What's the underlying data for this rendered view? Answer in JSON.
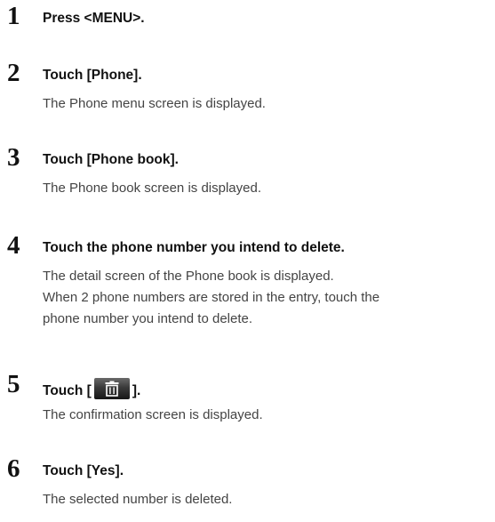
{
  "steps": [
    {
      "num": "1",
      "title": "Press <MENU>.",
      "desc": []
    },
    {
      "num": "2",
      "title": "Touch [Phone].",
      "desc": [
        "The Phone menu screen is displayed."
      ]
    },
    {
      "num": "3",
      "title": "Touch [Phone book].",
      "desc": [
        "The Phone book screen is displayed."
      ]
    },
    {
      "num": "4",
      "title": "Touch the phone number you intend to delete.",
      "desc": [
        "The detail screen of the Phone book is displayed.",
        "When 2 phone numbers are stored in the entry, touch the",
        "phone number you intend to delete."
      ]
    },
    {
      "num": "5",
      "title_prefix": "Touch [",
      "title_suffix": "].",
      "icon": "trash-icon",
      "desc": [
        "The confirmation screen is displayed."
      ]
    },
    {
      "num": "6",
      "title": "Touch [Yes].",
      "desc": [
        "The selected number is deleted."
      ]
    }
  ]
}
